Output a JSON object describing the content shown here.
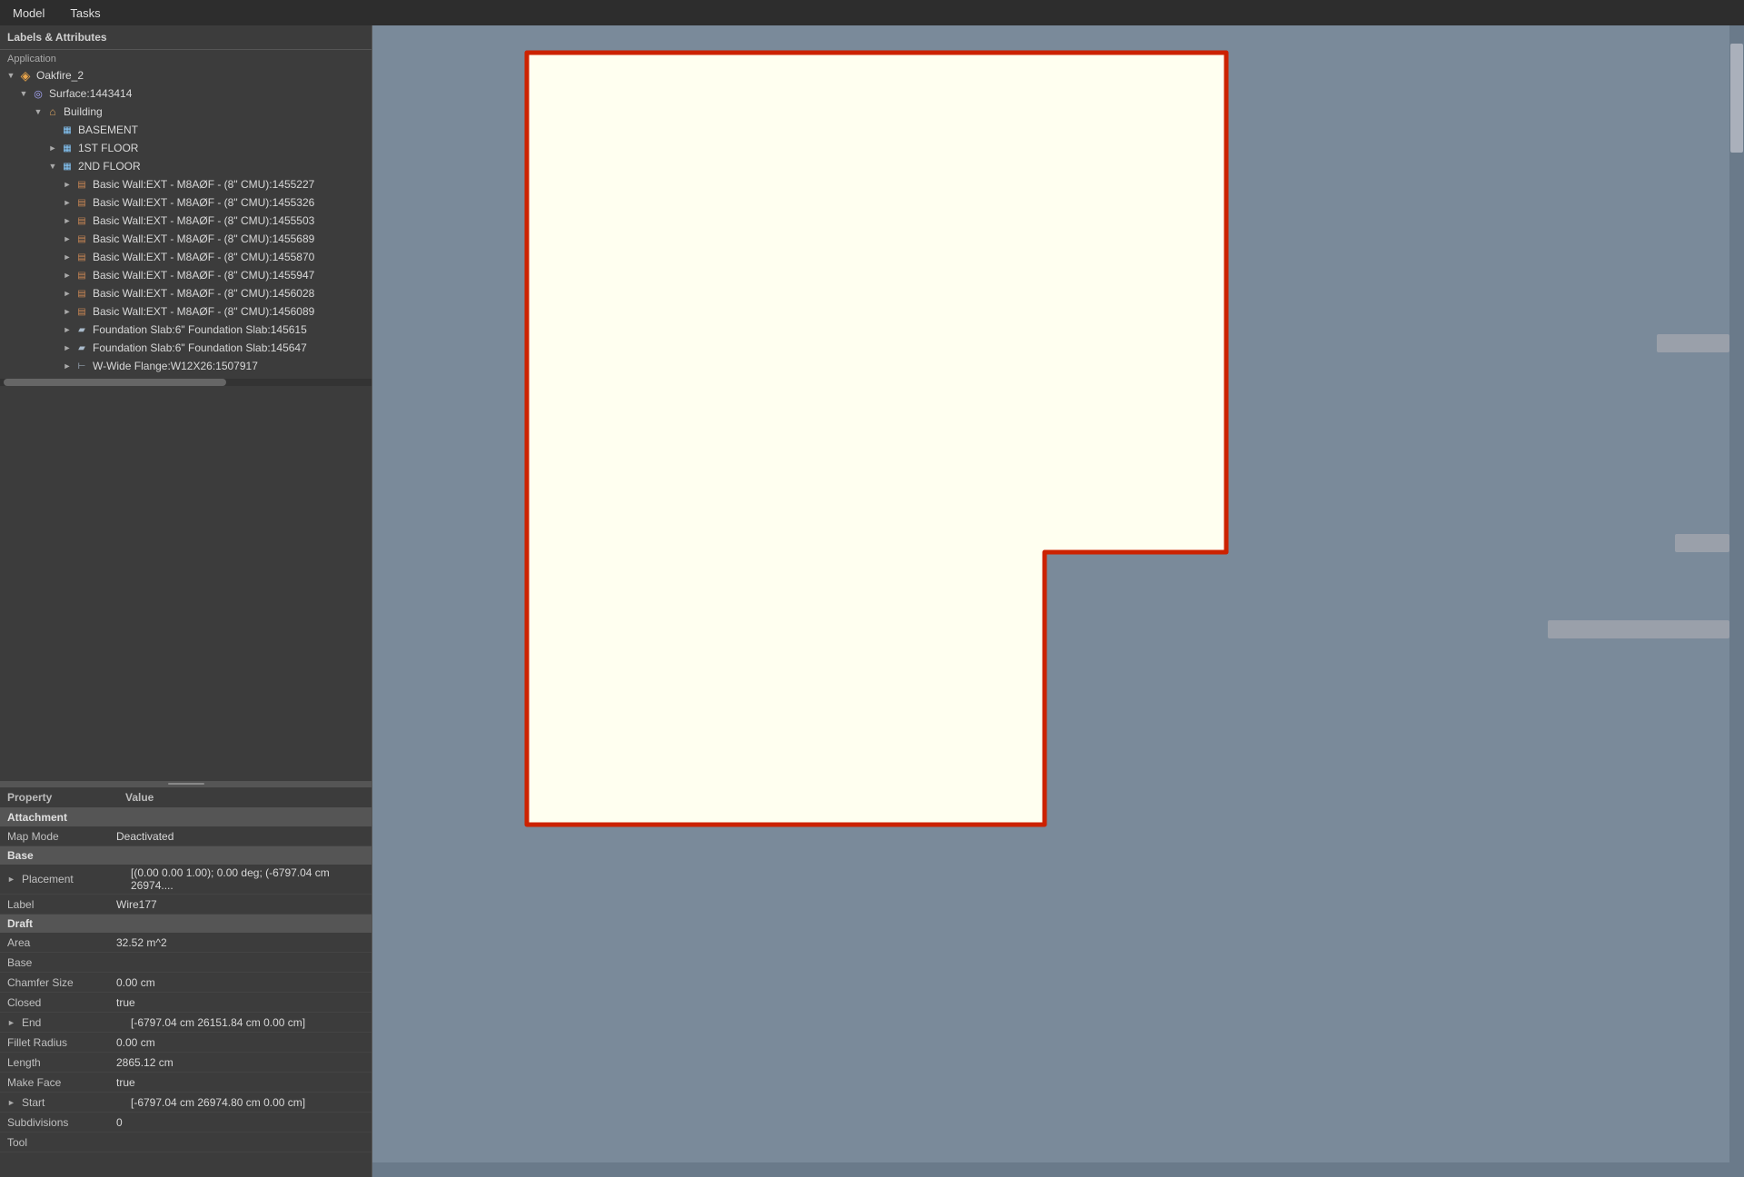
{
  "menubar": {
    "items": [
      "Model",
      "Tasks"
    ]
  },
  "panel": {
    "header": "Labels & Attributes",
    "section": "Application"
  },
  "tree": {
    "items": [
      {
        "id": "oakfire",
        "label": "Oakfire_2",
        "indent": 0,
        "arrow": "down",
        "icon": "project"
      },
      {
        "id": "surface",
        "label": "Surface:1443414",
        "indent": 1,
        "arrow": "down",
        "icon": "surface"
      },
      {
        "id": "building",
        "label": "Building",
        "indent": 2,
        "arrow": "down",
        "icon": "building"
      },
      {
        "id": "basement",
        "label": "BASEMENT",
        "indent": 3,
        "arrow": "none",
        "icon": "floor"
      },
      {
        "id": "1stfloor",
        "label": "1ST FLOOR",
        "indent": 3,
        "arrow": "right",
        "icon": "floor"
      },
      {
        "id": "2ndfloor",
        "label": "2ND FLOOR",
        "indent": 3,
        "arrow": "down",
        "icon": "floor"
      },
      {
        "id": "wall1",
        "label": "Basic Wall:EXT - M8AØF - (8\" CMU):1455227",
        "indent": 4,
        "arrow": "right",
        "icon": "wall"
      },
      {
        "id": "wall2",
        "label": "Basic Wall:EXT - M8AØF - (8\" CMU):1455326",
        "indent": 4,
        "arrow": "right",
        "icon": "wall"
      },
      {
        "id": "wall3",
        "label": "Basic Wall:EXT - M8AØF - (8\" CMU):1455503",
        "indent": 4,
        "arrow": "right",
        "icon": "wall"
      },
      {
        "id": "wall4",
        "label": "Basic Wall:EXT - M8AØF - (8\" CMU):1455689",
        "indent": 4,
        "arrow": "right",
        "icon": "wall"
      },
      {
        "id": "wall5",
        "label": "Basic Wall:EXT - M8AØF - (8\" CMU):1455870",
        "indent": 4,
        "arrow": "right",
        "icon": "wall"
      },
      {
        "id": "wall6",
        "label": "Basic Wall:EXT - M8AØF - (8\" CMU):1455947",
        "indent": 4,
        "arrow": "right",
        "icon": "wall"
      },
      {
        "id": "wall7",
        "label": "Basic Wall:EXT - M8AØF - (8\" CMU):1456028",
        "indent": 4,
        "arrow": "right",
        "icon": "wall"
      },
      {
        "id": "wall8",
        "label": "Basic Wall:EXT - M8AØF - (8\" CMU):1456089",
        "indent": 4,
        "arrow": "right",
        "icon": "wall"
      },
      {
        "id": "slab1",
        "label": "Foundation Slab:6\" Foundation Slab:145615",
        "indent": 4,
        "arrow": "right",
        "icon": "slab"
      },
      {
        "id": "slab2",
        "label": "Foundation Slab:6\" Foundation Slab:145647",
        "indent": 4,
        "arrow": "right",
        "icon": "slab"
      },
      {
        "id": "beam1",
        "label": "W-Wide Flange:W12X26:1507917",
        "indent": 4,
        "arrow": "right",
        "icon": "beam"
      }
    ]
  },
  "properties": {
    "col_property": "Property",
    "col_value": "Value",
    "groups": [
      {
        "name": "Attachment",
        "rows": [
          {
            "property": "Map Mode",
            "value": "Deactivated",
            "has_arrow": false
          }
        ]
      },
      {
        "name": "Base",
        "rows": [
          {
            "property": "Placement",
            "value": "[(0.00 0.00 1.00); 0.00 deg; (-6797.04 cm  26974....",
            "has_arrow": true
          },
          {
            "property": "Label",
            "value": "Wire177",
            "has_arrow": false
          }
        ]
      },
      {
        "name": "Draft",
        "rows": [
          {
            "property": "Area",
            "value": "32.52 m^2",
            "has_arrow": false
          },
          {
            "property": "Base",
            "value": "",
            "has_arrow": false
          },
          {
            "property": "Chamfer Size",
            "value": "0.00 cm",
            "has_arrow": false
          },
          {
            "property": "Closed",
            "value": "true",
            "has_arrow": false
          },
          {
            "property": "End",
            "value": "[-6797.04 cm  26151.84 cm  0.00 cm]",
            "has_arrow": true
          },
          {
            "property": "Fillet Radius",
            "value": "0.00 cm",
            "has_arrow": false
          },
          {
            "property": "Length",
            "value": "2865.12 cm",
            "has_arrow": false
          },
          {
            "property": "Make Face",
            "value": "true",
            "has_arrow": false
          },
          {
            "property": "Start",
            "value": "[-6797.04 cm  26974.80 cm  0.00 cm]",
            "has_arrow": true
          },
          {
            "property": "Subdivisions",
            "value": "0",
            "has_arrow": false
          },
          {
            "property": "Tool",
            "value": "",
            "has_arrow": false
          }
        ]
      }
    ]
  },
  "viewport": {
    "bg_color": "#7e8e9e",
    "shape_fill": "#fffff0",
    "shape_stroke": "#cc2200",
    "stroke_width": 4
  }
}
